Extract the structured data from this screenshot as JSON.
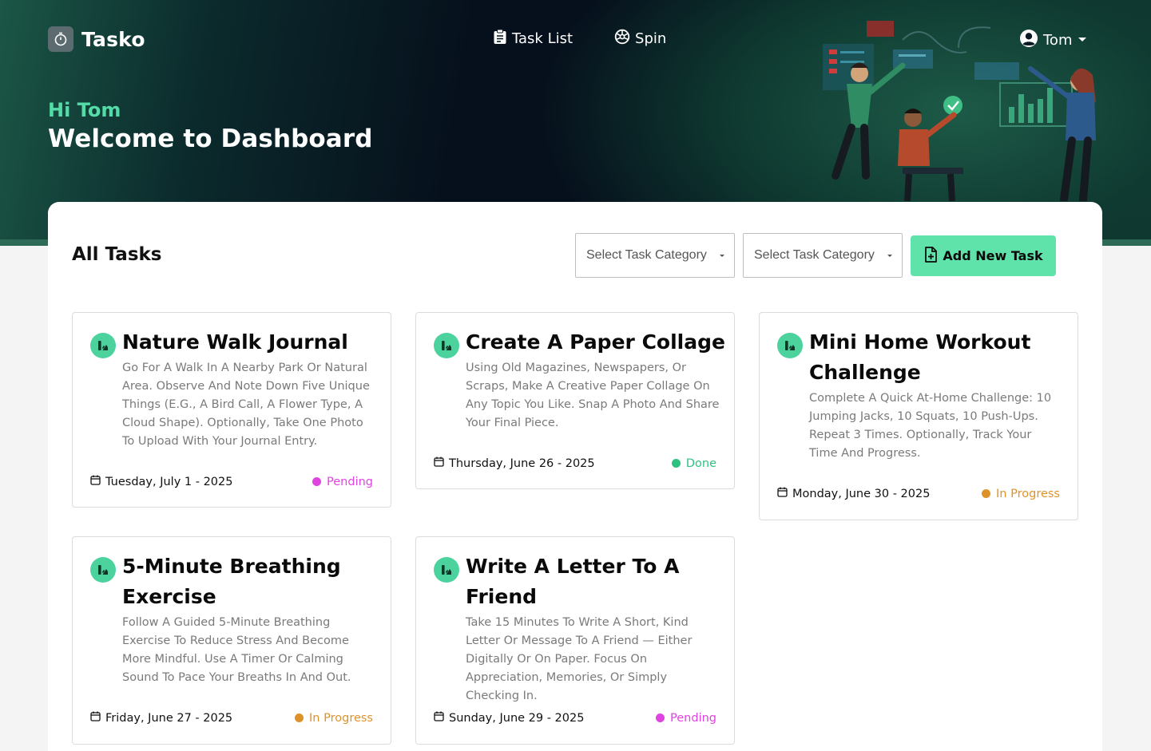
{
  "app": {
    "name": "Tasko"
  },
  "nav": {
    "task_list": "Task List",
    "spin": "Spin"
  },
  "user": {
    "name": "Tom"
  },
  "hero": {
    "greeting": "Hi Tom",
    "title": "Welcome to Dashboard"
  },
  "panel": {
    "title": "All Tasks",
    "filter1_placeholder": "Select Task Category",
    "filter2_placeholder": "Select Task Category",
    "add_button": "Add New Task"
  },
  "colors": {
    "accent": "#5fe3ab",
    "pending": "#e044e0",
    "done": "#2ec27e",
    "in_progress": "#e0922a"
  },
  "tasks": [
    {
      "title": "Nature Walk Journal",
      "description": "Go For A Walk In A Nearby Park Or Natural Area. Observe And Note Down Five Unique Things (E.G., A Bird Call, A Flower Type, A Cloud Shape). Optionally, Take One Photo To Upload With Your Journal Entry.",
      "date": "Tuesday, July 1 - 2025",
      "status": "Pending"
    },
    {
      "title": "Create A Paper Collage",
      "description": "Using Old Magazines, Newspapers, Or Scraps, Make A Creative Paper Collage On Any Topic You Like. Snap A Photo And Share Your Final Piece.",
      "date": "Thursday, June 26 - 2025",
      "status": "Done"
    },
    {
      "title": "Mini Home Workout Challenge",
      "description": "Complete A Quick At-Home Challenge: 10 Jumping Jacks, 10 Squats, 10 Push-Ups. Repeat 3 Times. Optionally, Track Your Time And Progress.",
      "date": "Monday, June 30 - 2025",
      "status": "In Progress"
    },
    {
      "title": "5-Minute Breathing Exercise",
      "description": "Follow A Guided 5-Minute Breathing Exercise To Reduce Stress And Become More Mindful. Use A Timer Or Calming Sound To Pace Your Breaths In And Out.",
      "date": "Friday, June 27 - 2025",
      "status": "In Progress"
    },
    {
      "title": "Write A Letter To A Friend",
      "description": "Take 15 Minutes To Write A Short, Kind Letter Or Message To A Friend — Either Digitally Or On Paper. Focus On Appreciation, Memories, Or Simply Checking In.",
      "date": "Sunday, June 29 - 2025",
      "status": "Pending"
    }
  ]
}
